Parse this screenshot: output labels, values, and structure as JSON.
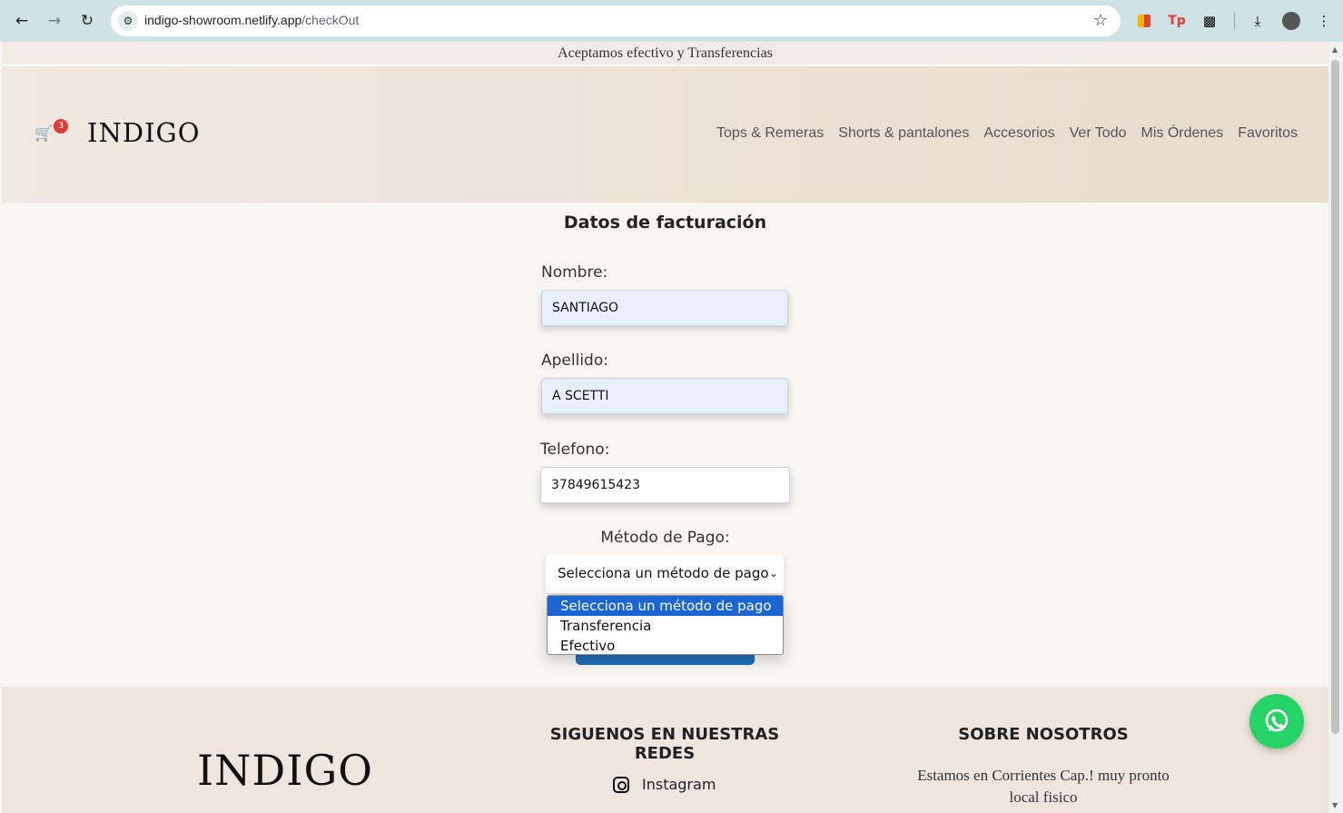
{
  "browser": {
    "url_host": "indigo-showroom.netlify.app",
    "url_path": "/checkOut"
  },
  "announcement": "Aceptamos efectivo y Transferencias",
  "header": {
    "brand": "INDIGO",
    "cart_count": "3",
    "menu": [
      "Tops & Remeras",
      "Shorts & pantalones",
      "Accesorios",
      "Ver Todo",
      "Mis Órdenes",
      "Favoritos"
    ]
  },
  "form": {
    "title": "Datos de facturación",
    "nombre_label": "Nombre:",
    "nombre_value": "SANTIAGO",
    "apellido_label": "Apellido:",
    "apellido_value": "A SCETTI",
    "telefono_label": "Telefono:",
    "telefono_value": "37849615423",
    "payment_label": "Método de Pago:",
    "payment_selected": "Selecciona un método de pago",
    "payment_options": [
      "Selecciona un método de pago",
      "Transferencia",
      "Efectivo"
    ]
  },
  "footer": {
    "brand": "INDIGO",
    "social_heading": "SIGUENOS EN NUESTRAS REDES",
    "instagram_label": "Instagram",
    "about_heading": "SOBRE NOSOTROS",
    "about_text": "Estamos en Corrientes Cap.! muy pronto local fisico"
  },
  "colors": {
    "accent_blue": "#1a66d2",
    "whatsapp_green": "#25d366",
    "cart_badge": "#e53935"
  }
}
